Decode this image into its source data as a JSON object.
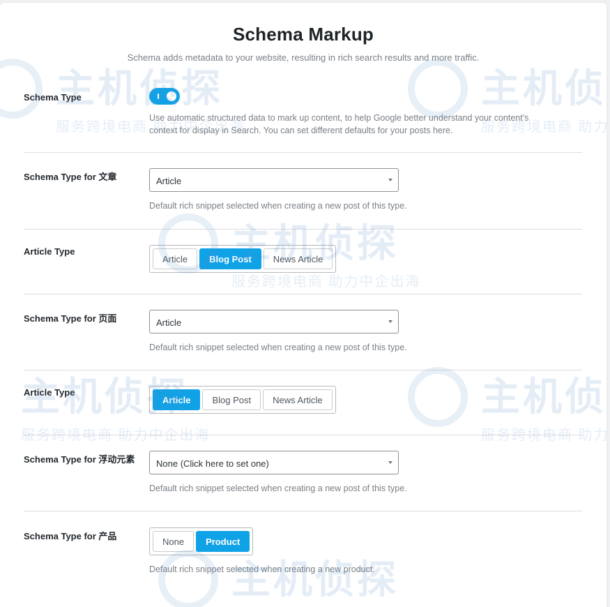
{
  "header": {
    "title": "Schema Markup",
    "subtitle": "Schema adds metadata to your website, resulting in rich search results and more traffic."
  },
  "schema_type": {
    "label": "Schema Type",
    "enabled": true,
    "desc_line1": "Use automatic structured data to mark up content, to help Google better understand your content's",
    "desc_line2": "context for display in Search. You can set different defaults for your posts here."
  },
  "post_schema": {
    "label": "Schema Type for 文章",
    "value": "Article",
    "desc": "Default rich snippet selected when creating a new post of this type."
  },
  "post_article_type": {
    "label": "Article Type",
    "options": [
      "Article",
      "Blog Post",
      "News Article"
    ],
    "selected": "Blog Post"
  },
  "page_schema": {
    "label": "Schema Type for 页面",
    "value": "Article",
    "desc": "Default rich snippet selected when creating a new post of this type."
  },
  "page_article_type": {
    "label": "Article Type",
    "options": [
      "Article",
      "Blog Post",
      "News Article"
    ],
    "selected": "Article"
  },
  "float_schema": {
    "label": "Schema Type for 浮动元素",
    "value": "None (Click here to set one)",
    "desc": "Default rich snippet selected when creating a new post of this type."
  },
  "product_schema": {
    "label": "Schema Type for 产品",
    "options": [
      "None",
      "Product"
    ],
    "selected": "Product",
    "desc": "Default rich snippet selected when creating a new product."
  },
  "watermark": {
    "brand": "主机侦探",
    "slogan": "服务跨境电商 助力中企出海"
  },
  "colors": {
    "accent": "#10a2e6",
    "text": "#1d2327",
    "muted": "#7a7f85",
    "divider": "#dcdcde"
  }
}
